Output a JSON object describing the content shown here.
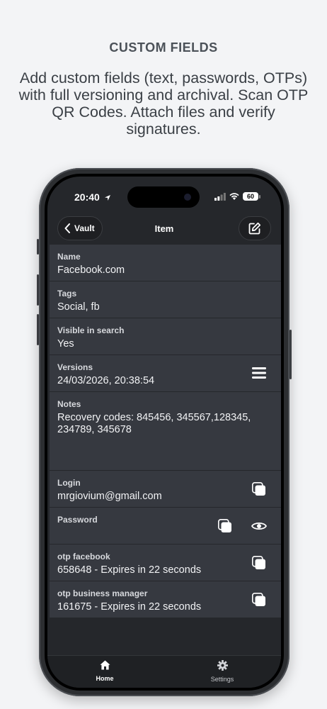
{
  "promo": {
    "heading": "CUSTOM FIELDS",
    "subheading": "Add custom fields (text, passwords, OTPs) with full versioning and archival. Scan OTP QR Codes. Attach files and verify signatures."
  },
  "status_bar": {
    "time": "20:40",
    "battery": "60"
  },
  "nav": {
    "back_label": "Vault",
    "title": "Item"
  },
  "fields": {
    "name": {
      "label": "Name",
      "value": "Facebook.com"
    },
    "tags": {
      "label": "Tags",
      "value": "Social, fb"
    },
    "visible": {
      "label": "Visible in search",
      "value": "Yes"
    },
    "versions": {
      "label": "Versions",
      "value": "24/03/2026, 20:38:54"
    },
    "notes": {
      "label": "Notes",
      "value": "Recovery codes: 845456, 345567,128345, 234789, 345678"
    },
    "login": {
      "label": "Login",
      "value": "mrgiovium@gmail.com"
    },
    "password": {
      "label": "Password",
      "value": ""
    },
    "otp_facebook": {
      "label": "otp facebook",
      "value": "658648 - Expires in 22 seconds"
    },
    "otp_business": {
      "label": "otp business manager",
      "value": "161675 - Expires in 22 seconds"
    }
  },
  "tabs": [
    {
      "label": "Home",
      "icon": "home-icon",
      "active": true
    },
    {
      "label": "Settings",
      "icon": "gear-icon",
      "active": false
    }
  ],
  "colors": {
    "page_bg": "#f3f4f6",
    "screen_bg": "#25272b",
    "row_bg": "#363940"
  }
}
